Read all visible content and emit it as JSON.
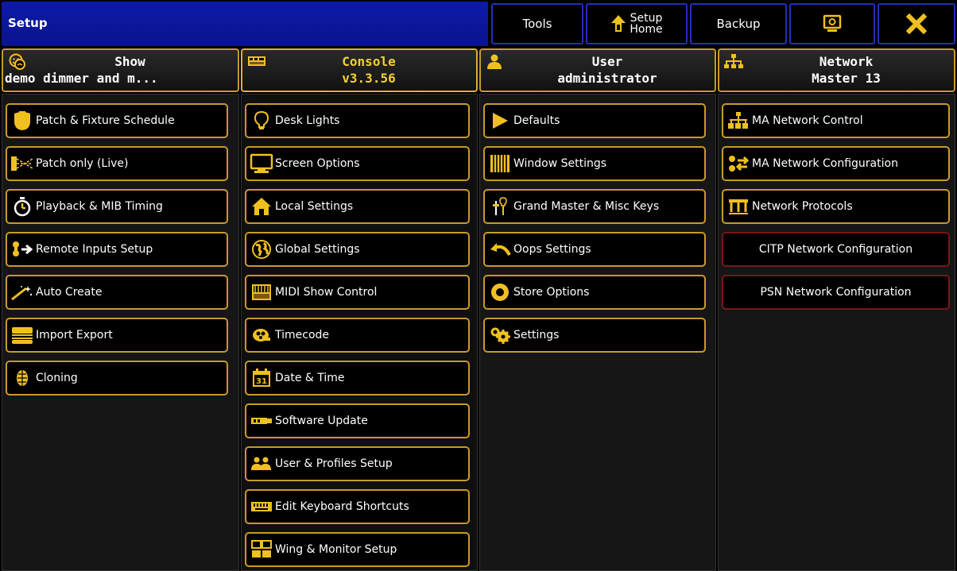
{
  "titlebar": {
    "title": "Setup",
    "tools": "Tools",
    "setup_home_line1": "Setup",
    "setup_home_line2": "Home",
    "backup": "Backup"
  },
  "columns": [
    {
      "line1": "Show",
      "line2": "demo dimmer and m..."
    },
    {
      "line1": "Console",
      "line2": "v3.3.56"
    },
    {
      "line1": "User",
      "line2": "administrator"
    },
    {
      "line1": "Network",
      "line2": "Master 13"
    }
  ],
  "show_items": [
    {
      "label": "Patch & Fixture Schedule",
      "icon": "patch-fixture-icon"
    },
    {
      "label": "Patch only (Live)",
      "icon": "patch-live-icon"
    },
    {
      "label": "Playback & MIB Timing",
      "icon": "stopwatch-icon"
    },
    {
      "label": "Remote Inputs Setup",
      "icon": "remote-inputs-icon"
    },
    {
      "label": "Auto Create",
      "icon": "auto-create-icon"
    },
    {
      "label": "Import Export",
      "icon": "import-export-icon"
    },
    {
      "label": "Cloning",
      "icon": "cloning-icon"
    }
  ],
  "console_items": [
    {
      "label": "Desk Lights",
      "icon": "lightbulb-icon"
    },
    {
      "label": "Screen Options",
      "icon": "monitor-icon"
    },
    {
      "label": "Local Settings",
      "icon": "home-icon"
    },
    {
      "label": "Global Settings",
      "icon": "globe-icon"
    },
    {
      "label": "MIDI Show Control",
      "icon": "midi-icon"
    },
    {
      "label": "Timecode",
      "icon": "timecode-icon"
    },
    {
      "label": "Date & Time",
      "icon": "calendar-icon"
    },
    {
      "label": "Software Update",
      "icon": "usb-icon"
    },
    {
      "label": "User & Profiles Setup",
      "icon": "users-icon"
    },
    {
      "label": "Edit Keyboard Shortcuts",
      "icon": "keyboard-icon"
    },
    {
      "label": "Wing & Monitor Setup",
      "icon": "wing-monitor-icon"
    }
  ],
  "user_items": [
    {
      "label": "Defaults",
      "icon": "play-icon"
    },
    {
      "label": "Window Settings",
      "icon": "window-settings-icon"
    },
    {
      "label": "Grand Master & Misc Keys",
      "icon": "grand-master-icon"
    },
    {
      "label": "Oops Settings",
      "icon": "undo-icon"
    },
    {
      "label": "Store Options",
      "icon": "store-options-icon"
    },
    {
      "label": "Settings",
      "icon": "gears-icon"
    }
  ],
  "network_items": [
    {
      "label": "MA Network Control",
      "icon": "network-control-icon"
    },
    {
      "label": "MA Network Configuration",
      "icon": "network-config-icon"
    },
    {
      "label": "Network Protocols",
      "icon": "network-protocols-icon"
    },
    {
      "label": "CITP Network Configuration",
      "icon": ""
    },
    {
      "label": "PSN Network Configuration",
      "icon": ""
    }
  ],
  "colors": {
    "accent": "#f0c020",
    "border": "#c89a2a",
    "title_blue": "#0c1aa8",
    "disabled_border": "#7a1616"
  }
}
